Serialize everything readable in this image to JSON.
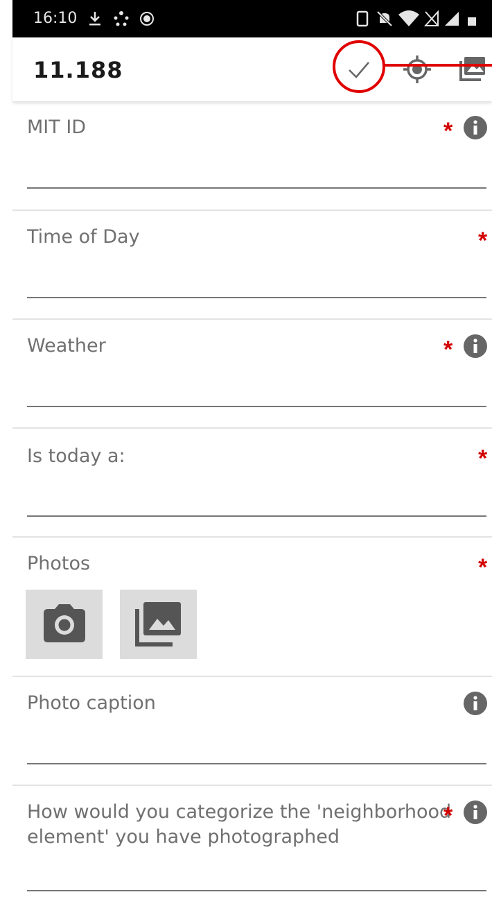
{
  "status_bar": {
    "time": "16:10"
  },
  "app_bar": {
    "title": "11.188"
  },
  "form": {
    "fields": [
      {
        "label": "MIT ID",
        "required_mark": "*"
      },
      {
        "label": "Time of Day",
        "required_mark": "*"
      },
      {
        "label": "Weather",
        "required_mark": "*"
      },
      {
        "label": "Is today a:",
        "required_mark": "*"
      },
      {
        "label": "Photos",
        "required_mark": "*"
      },
      {
        "label": "Photo caption"
      },
      {
        "label": "How would you categorize the 'neighborhood element' you have photographed",
        "required_mark": "*"
      }
    ]
  },
  "icons": {
    "save": "check-icon",
    "location": "gps-target-icon",
    "gallery": "photo-library-icon",
    "camera": "camera-icon",
    "info": "info-icon"
  },
  "colors": {
    "required": "#d40000",
    "annotation": "#e00000",
    "label": "#707070",
    "status_bar": "#000000"
  }
}
